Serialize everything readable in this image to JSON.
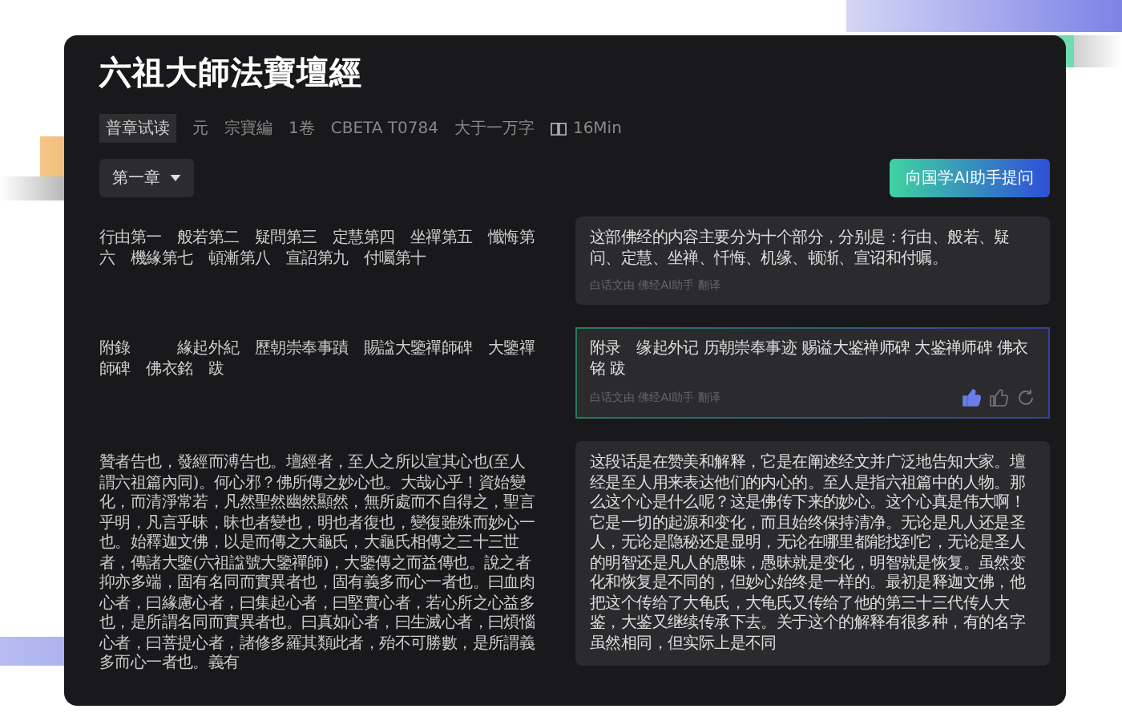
{
  "title": "六祖大師法寶壇經",
  "meta": [
    {
      "text": "普章试读",
      "kind": "tag"
    },
    {
      "text": "元",
      "kind": "plain"
    },
    {
      "text": "宗寶編",
      "kind": "plain"
    },
    {
      "text": "1卷",
      "kind": "plain"
    },
    {
      "text": "CBETA T0784",
      "kind": "plain"
    },
    {
      "text": "大于一万字",
      "kind": "plain"
    },
    {
      "text": "16Min",
      "kind": "time"
    }
  ],
  "chapter_dropdown": "第一章",
  "ask_button": "向国学AI助手提问",
  "passages": [
    {
      "original": "行由第一　般若第二　疑問第三　定慧第四　坐禪第五　懺悔第六　機緣第七　頓漸第八　宣詔第九　付囑第十",
      "translation": "这部佛经的内容主要分为十个部分，分别是：行由、般若、疑问、定慧、坐禅、忏悔、机缘、顿渐、宣诏和付嘱。",
      "footer": "白话文由 佛经AI助手 翻译",
      "active": false
    },
    {
      "original": "附錄　　　緣起外紀　歷朝崇奉事蹟　賜諡大鑒禪師碑　大鑒禪師碑　佛衣銘　跋",
      "translation": "附录　缘起外记 历朝崇奉事迹 赐谥大鉴禅师碑 大鉴禅师碑 佛衣铭 跋",
      "footer": "白话文由 佛经AI助手 翻译",
      "active": true,
      "liked": true
    },
    {
      "original": "贊者告也，發經而溥告也。壇經者，至人之所以宣其心也(至人謂六祖篇內同)。何心邪？佛所傳之妙心也。大哉心乎！資始變化，而清淨常若，凡然聖然幽然顯然，無所處而不自得之，聖言乎明，凡言乎昧，昧也者變也，明也者復也，變復雖殊而妙心一也。始釋迦文佛，以是而傳之大龜氏，大龜氏相傳之三十三世者，傳諸大鑒(六祖諡號大鑒禪師)，大鑒傳之而益傳也。說之者抑亦多端，固有名同而實異者也，固有義多而心一者也。曰血肉心者，曰緣慮心者，曰集起心者，曰堅實心者，若心所之心益多也，是所謂名同而實異者也。曰真如心者，曰生滅心者，曰煩惱心者，曰菩提心者，諸修多羅其類此者，殆不可勝數，是所謂義多而心一者也。義有",
      "translation": "这段话是在赞美和解释，它是在阐述经文并广泛地告知大家。壇经是至人用来表达他们的内心的。至人是指六祖篇中的人物。那么这个心是什么呢？这是佛传下来的妙心。这个心真是伟大啊！它是一切的起源和变化，而且始终保持清净。无论是凡人还是圣人，无论是隐秘还是显明，无论在哪里都能找到它，无论是圣人的明智还是凡人的愚昧，愚昧就是变化，明智就是恢复。虽然变化和恢复是不同的，但妙心始终是一样的。最初是释迦文佛，他把这个传给了大龟氏，大龟氏又传给了他的第三十三代传人大鉴，大鉴又继续传承下去。关于这个的解释有很多种，有的名字虽然相同，但实际上是不同",
      "active": false
    }
  ]
}
